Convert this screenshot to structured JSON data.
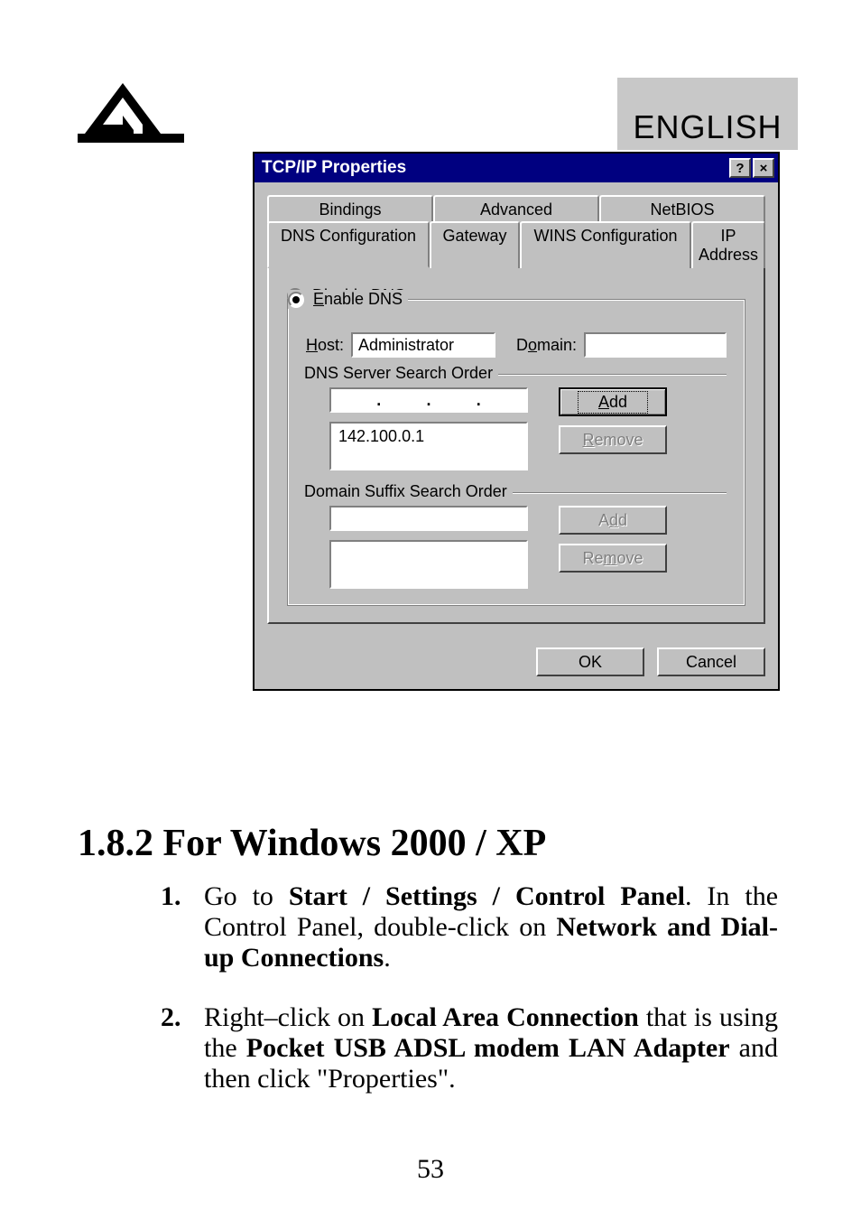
{
  "header": {
    "lang": "ENGLISH"
  },
  "dialog": {
    "title": "TCP/IP Properties",
    "help_glyph": "?",
    "close_glyph": "×",
    "tabs_top": [
      "Bindings",
      "Advanced",
      "NetBIOS"
    ],
    "tabs_bottom": [
      "DNS Configuration",
      "Gateway",
      "WINS Configuration",
      "IP Address"
    ],
    "disable_label": "Disable DNS",
    "enable_label": "Enable DNS",
    "host_label": "Host:",
    "host_value": "Administrator",
    "domain_label": "Domain:",
    "domain_value": "",
    "dns_section": "DNS Server Search Order",
    "dns_entry": "142.100.0.1",
    "add_label": "Add",
    "remove_label": "Remove",
    "suffix_section": "Domain Suffix Search Order",
    "ok_label": "OK",
    "cancel_label": "Cancel"
  },
  "content": {
    "heading": "1.8.2 For Windows 2000 / XP",
    "bullet1_num": "1.",
    "bullet1_pre": "Go to ",
    "bullet1_b1": "Start / Settings / Control Panel",
    "bullet1_mid": ". In the Control Panel, double-click on ",
    "bullet1_b2": "Network and Dial-up Connections",
    "bullet1_post": ".",
    "bullet2_num": "2.",
    "bullet2_pre": "Right–click on ",
    "bullet2_b1": "Local Area Connection",
    "bullet2_mid": " that is using the ",
    "bullet2_b2": "Pocket USB ADSL modem LAN Adapter",
    "bullet2_post": " and then click \"Properties\"."
  },
  "page": "53"
}
